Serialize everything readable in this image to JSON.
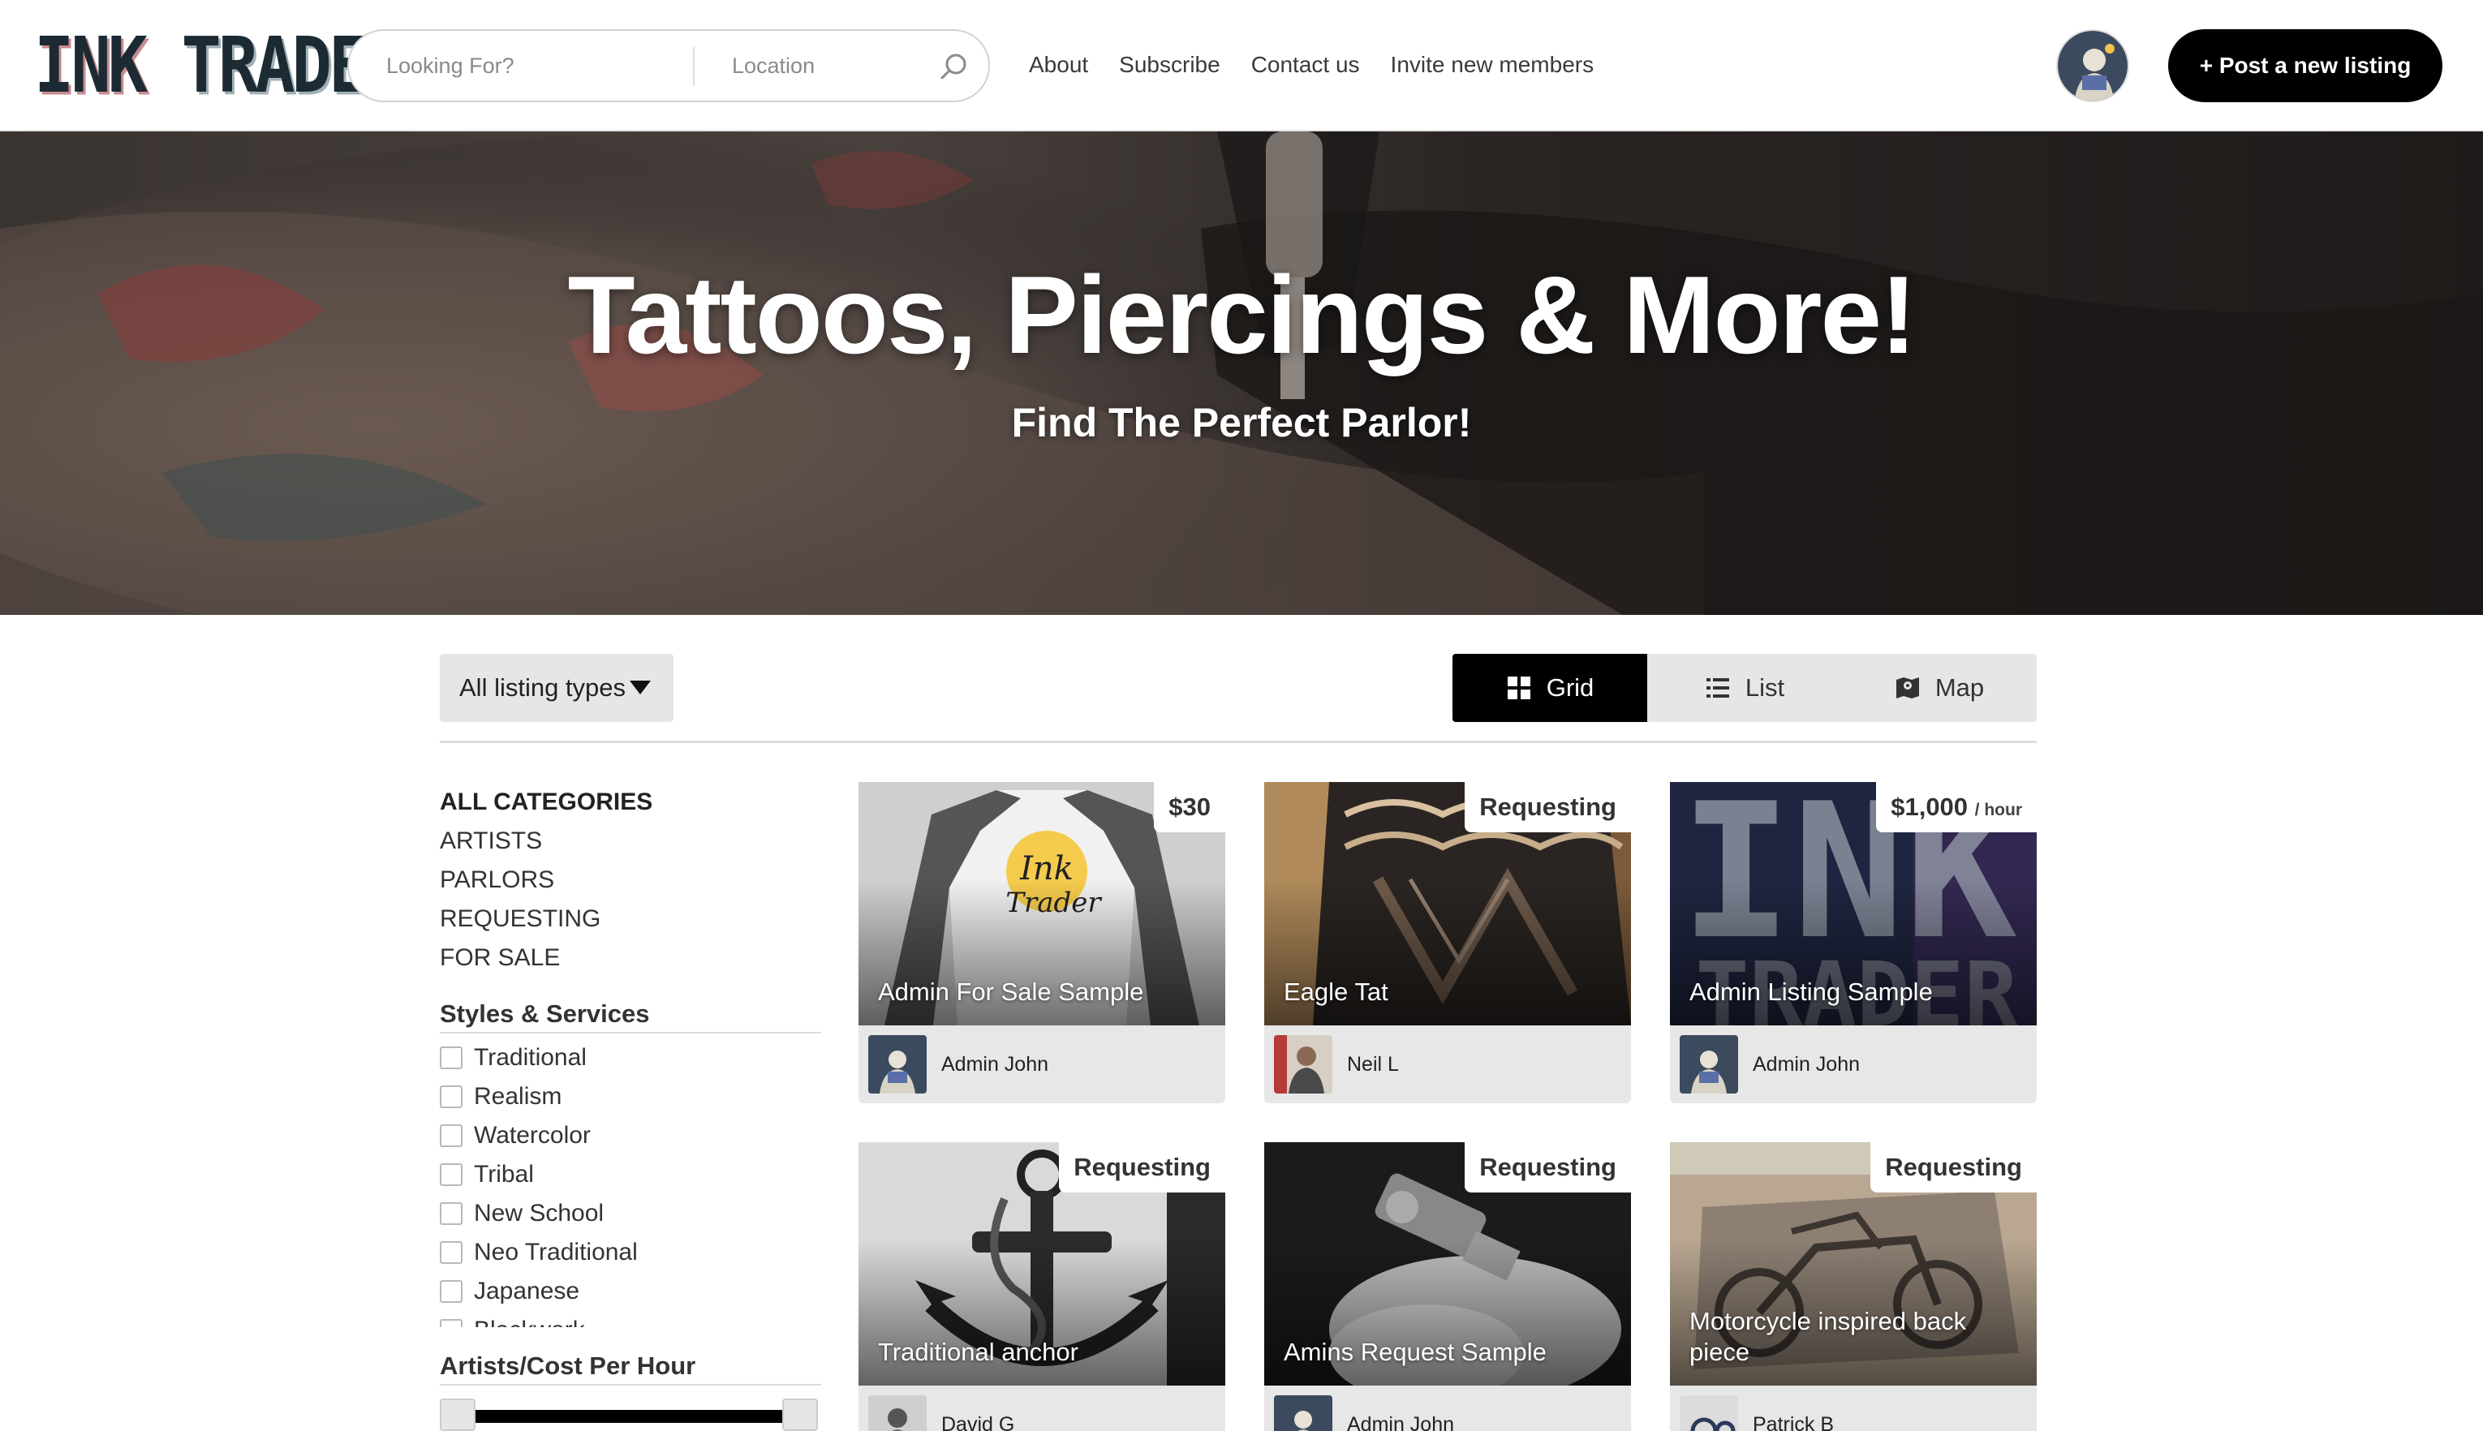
{
  "brand": {
    "logo_part1": "INK",
    "logo_part2": "TRADER",
    "logo_text": "INK TRADER"
  },
  "search": {
    "query_placeholder": "Looking For?",
    "query_value": "",
    "location_placeholder": "Location",
    "location_value": "",
    "button_icon": "search-icon"
  },
  "nav": {
    "items": [
      "About",
      "Subscribe",
      "Contact us",
      "Invite new members"
    ]
  },
  "header": {
    "post_label": "+ Post a new listing",
    "avatar_icon": "user-avatar"
  },
  "hero": {
    "title": "Tattoos, Piercings & More!",
    "subtitle": "Find The Perfect Parlor!"
  },
  "filters": {
    "listing_type": "All listing types",
    "views": [
      {
        "label": "Grid",
        "icon": "grid-icon",
        "active": true
      },
      {
        "label": "List",
        "icon": "list-icon",
        "active": false
      },
      {
        "label": "Map",
        "icon": "map-icon",
        "active": false
      }
    ]
  },
  "sidebar": {
    "categories": [
      "ALL CATEGORIES",
      "ARTISTS",
      "PARLORS",
      "REQUESTING",
      "FOR SALE"
    ],
    "styles_title": "Styles & Services",
    "styles": [
      "Traditional",
      "Realism",
      "Watercolor",
      "Tribal",
      "New School",
      "Neo Traditional",
      "Japanese",
      "Blackwork"
    ],
    "price_title": "Artists/Cost Per Hour"
  },
  "listings": [
    {
      "title": "Admin For Sale Sample",
      "price": "$30",
      "unit": "",
      "author": "Admin John",
      "image": "ink-trader-shirt"
    },
    {
      "title": "Eagle Tat",
      "price": "Requesting",
      "unit": "",
      "author": "Neil L",
      "image": "arm-tattoo"
    },
    {
      "title": "Admin Listing Sample",
      "price": "$1,000",
      "unit": "/ hour",
      "author": "Admin John",
      "image": "ink-trader-logo"
    },
    {
      "title": "Traditional anchor",
      "price": "Requesting",
      "unit": "",
      "author": "David G",
      "image": "anchor-tattoo"
    },
    {
      "title": "Amins Request Sample",
      "price": "Requesting",
      "unit": "",
      "author": "Admin John",
      "image": "tattoo-machine"
    },
    {
      "title": "Motorcycle inspired back piece",
      "price": "Requesting",
      "unit": "",
      "author": "Patrick B",
      "image": "motorcycle-tattoo"
    }
  ],
  "colors": {
    "accent": "#000000",
    "panel": "#e6e6e6",
    "text": "#222222"
  }
}
